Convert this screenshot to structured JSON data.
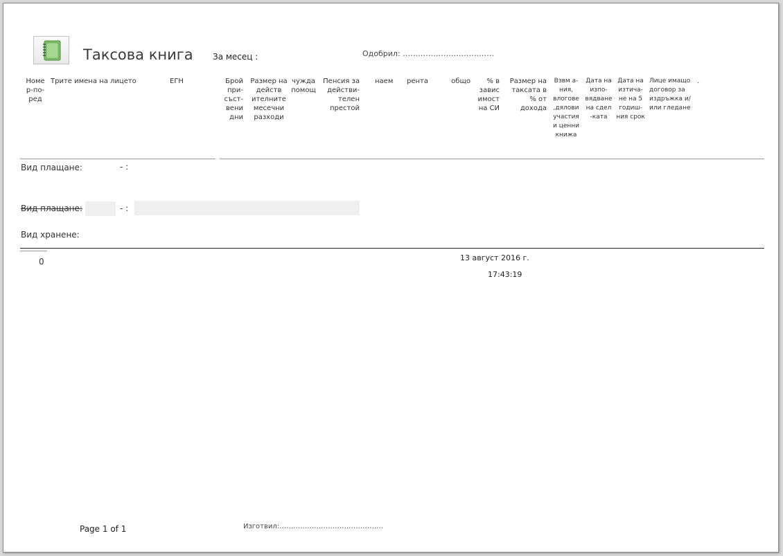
{
  "report": {
    "title": "Таксова книга",
    "month_label": "За месец :",
    "approved_label": "Одобрил: ………………………………"
  },
  "columns": [
    {
      "key": "num",
      "label": "Номе р-по-ред"
    },
    {
      "key": "names",
      "label": "Трите имена на лицето"
    },
    {
      "key": "egn",
      "label": "ЕГН"
    },
    {
      "key": "days",
      "label": "Брой при-съст-вени дни"
    },
    {
      "key": "expenses",
      "label": "Размер на действ ителните месечни разходи"
    },
    {
      "key": "help",
      "label": "чужда помощ"
    },
    {
      "key": "pension",
      "label": "Пенсия за действи-телен престой"
    },
    {
      "key": "rent1",
      "label": "наем"
    },
    {
      "key": "rent2",
      "label": "рента"
    },
    {
      "key": "total",
      "label": "общо"
    },
    {
      "key": "percent",
      "label": "% в завис имост на СИ"
    },
    {
      "key": "fee",
      "label": "Размер на таксата в % от дохода"
    },
    {
      "key": "rewards",
      "label": "Взвм а-ния, влогове ,дялови участия и ценни книжа"
    },
    {
      "key": "deal_date",
      "label": "Дата на изпо-вядване на сдел -ката"
    },
    {
      "key": "expire_date",
      "label": "Дата на изтича-не на 5 годиш-ния срок"
    },
    {
      "key": "person",
      "label": "Лице имащо договор за издръжка и/или гледане"
    },
    {
      "key": "dot",
      "label": "."
    }
  ],
  "groups": {
    "payment_label": "Вид плащане:",
    "dash": "- :",
    "payment_label2": "Вид плащане:",
    "dash2": "- :",
    "food_label": "Вид хранене:"
  },
  "summary": {
    "count": "0",
    "date": "13 август 2016 г.",
    "time": "17:43:19"
  },
  "footer": {
    "page": "Page 1 of 1",
    "prepared": "Изготвил:………………………………………"
  }
}
